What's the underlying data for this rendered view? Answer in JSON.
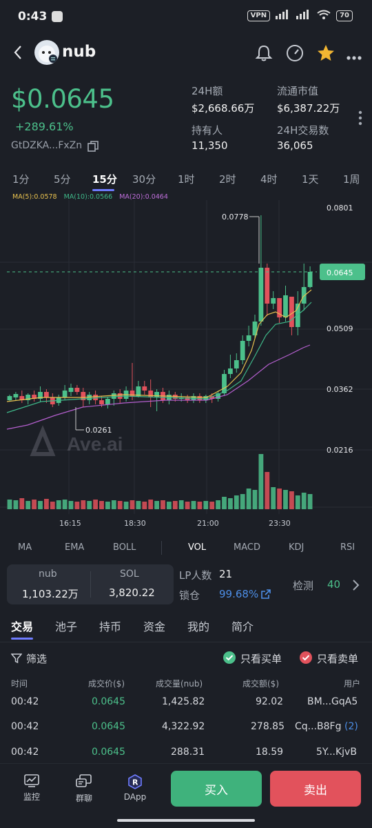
{
  "status": {
    "time": "0:43",
    "vpn": "VPN",
    "battery": "70"
  },
  "header": {
    "token": "nub"
  },
  "price": {
    "value": "$0.0645",
    "change": "+289.61%",
    "address": "GtDZKA...FxZn"
  },
  "stats": [
    {
      "label": "24H额",
      "value": "$2,668.66万"
    },
    {
      "label": "流通市值",
      "value": "$6,387.22万"
    },
    {
      "label": "持有人",
      "value": "11,350"
    },
    {
      "label": "24H交易数",
      "value": "36,065"
    }
  ],
  "timeframes": [
    "1分",
    "5分",
    "15分",
    "30分",
    "1时",
    "2时",
    "4时",
    "1天",
    "1周"
  ],
  "active_timeframe": "15分",
  "ma": {
    "ma5": "MA(5):0.0578",
    "ma10": "MA(10):0.0566",
    "ma20": "MA(20):0.0464"
  },
  "chart_data": {
    "type": "candlestick",
    "y_ticks": [
      "0.0801",
      "0.0509",
      "0.0362",
      "0.0216"
    ],
    "x_ticks": [
      "16:15",
      "18:30",
      "21:00",
      "23:30"
    ],
    "high_label": "0.0778",
    "low_label": "0.0261",
    "current_price": "0.0645",
    "watermark": "Ave.ai",
    "colors": {
      "up": "#4cc08b",
      "down": "#e2525c",
      "ma5": "#e8c14f",
      "ma10": "#3fb98a",
      "ma20": "#b660d0"
    }
  },
  "indicators": [
    "MA",
    "EMA",
    "BOLL",
    "VOL",
    "MACD",
    "KDJ",
    "RSI"
  ],
  "liquidity": {
    "token_label": "nub",
    "token_amount": "1,103.22万",
    "sol_label": "SOL",
    "sol_amount": "3,820.22",
    "lp_label": "LP人数",
    "lp_count": "21",
    "lock_label": "锁仓",
    "lock_pct": "99.68%",
    "check_label": "检测",
    "check_score": "40"
  },
  "tabs": [
    "交易",
    "池子",
    "持币",
    "资金",
    "我的",
    "简介"
  ],
  "filter": {
    "label": "筛选",
    "buy_only": "只看买单",
    "sell_only": "只看卖单"
  },
  "table": {
    "headers": [
      "时间",
      "成交价($)",
      "成交量(nub)",
      "成交额($)",
      "用户"
    ],
    "rows": [
      {
        "time": "00:42",
        "price": "0.0645",
        "qty": "1,425.82",
        "amount": "92.02",
        "user": "BM...GqA5",
        "count": ""
      },
      {
        "time": "00:42",
        "price": "0.0645",
        "qty": "4,322.92",
        "amount": "278.85",
        "user": "Cq...B8Fg",
        "count": "(2)"
      },
      {
        "time": "00:42",
        "price": "0.0645",
        "qty": "288.31",
        "amount": "18.59",
        "user": "5Y...KjvB",
        "count": ""
      }
    ]
  },
  "nav": {
    "monitor": "监控",
    "chat": "群聊",
    "dapp": "DApp",
    "buy": "买入",
    "sell": "卖出"
  }
}
